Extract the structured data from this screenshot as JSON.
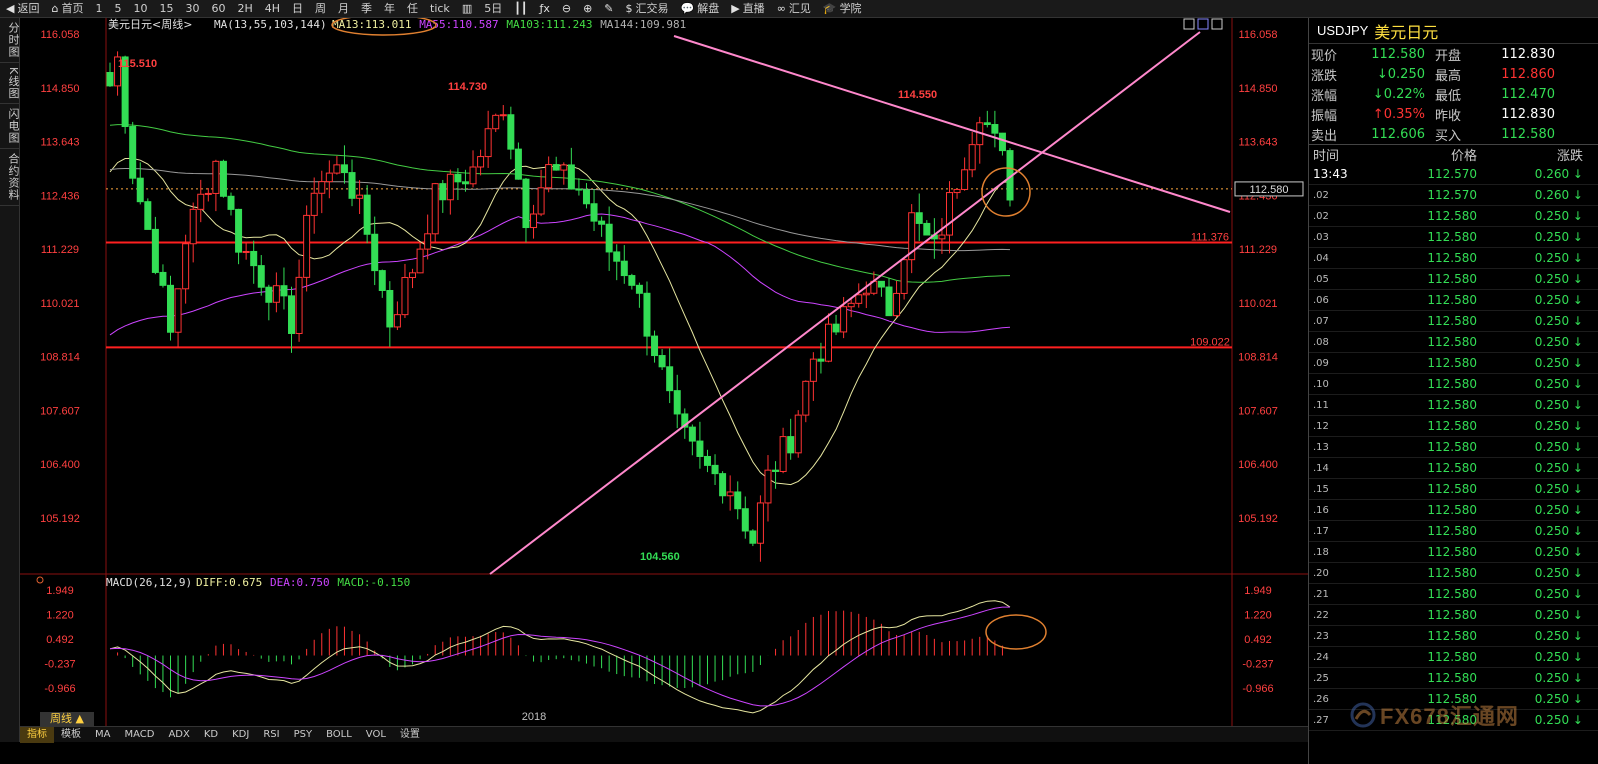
{
  "toolbar": {
    "items": [
      {
        "icon": "back-arrow-icon",
        "glyph": "◀",
        "label": "返回"
      },
      {
        "icon": "home-icon",
        "glyph": "⌂",
        "label": "首页"
      },
      {
        "label": "1"
      },
      {
        "label": "5"
      },
      {
        "label": "10"
      },
      {
        "label": "15"
      },
      {
        "label": "30"
      },
      {
        "label": "60"
      },
      {
        "label": "2H"
      },
      {
        "label": "4H"
      },
      {
        "label": "日"
      },
      {
        "label": "周"
      },
      {
        "label": "月"
      },
      {
        "label": "季"
      },
      {
        "label": "年"
      },
      {
        "label": "任"
      },
      {
        "label": "tick"
      },
      {
        "icon": "candlestick-icon",
        "glyph": "▥",
        "label": ""
      },
      {
        "label": "5日"
      },
      {
        "icon": "bars-icon",
        "glyph": "┃┃",
        "label": ""
      },
      {
        "icon": "fx-icon",
        "glyph": "ƒx",
        "label": ""
      },
      {
        "icon": "zoom-out-icon",
        "glyph": "⊖",
        "label": ""
      },
      {
        "icon": "zoom-in-icon",
        "glyph": "⊕",
        "label": ""
      },
      {
        "icon": "pen-icon",
        "glyph": "✎",
        "label": ""
      },
      {
        "icon": "dollar-icon",
        "glyph": "$",
        "label": "汇交易"
      },
      {
        "icon": "chat-icon",
        "glyph": "💬",
        "label": "解盘"
      },
      {
        "icon": "play-icon",
        "glyph": "▶",
        "label": "直播"
      },
      {
        "icon": "link-icon",
        "glyph": "∞",
        "label": "汇见"
      },
      {
        "icon": "graduation-cap-icon",
        "glyph": "🎓",
        "label": "学院"
      }
    ]
  },
  "left_tabs": [
    "分时图",
    "K线图",
    "闪电图",
    "合约资料"
  ],
  "main_chart": {
    "title": "美元日元<周线>",
    "ma_label": "MA(13,55,103,144)",
    "ma_values": [
      {
        "text": "MA13:113.011",
        "color": "#f0f0a0"
      },
      {
        "text": "MA55:110.587",
        "color": "#cc44ff"
      },
      {
        "text": "MA103:111.243",
        "color": "#44dd44"
      },
      {
        "text": "MA144:109.981",
        "color": "#b0b0b0"
      }
    ],
    "y_ticks": [
      "116.058",
      "114.850",
      "113.643",
      "112.436",
      "111.229",
      "110.021",
      "108.814",
      "107.607",
      "106.400",
      "105.192"
    ],
    "current_price_label": "112.580",
    "hline_labels": [
      "111.376",
      "109.022"
    ],
    "annotations": [
      "115.510",
      "114.730",
      "114.550",
      "104.560"
    ]
  },
  "macd": {
    "label": "MACD(26,12,9)",
    "values": [
      {
        "text": "DIFF:0.675",
        "color": "#f0f0a0"
      },
      {
        "text": "DEA:0.750",
        "color": "#cc44ff"
      },
      {
        "text": "MACD:-0.150",
        "color": "#44dd44"
      }
    ],
    "y_ticks": [
      "1.949",
      "1.220",
      "0.492",
      "-0.237",
      "-0.966"
    ]
  },
  "x_axis_label": "2018",
  "period_tab": "周线 ▲",
  "bottom_tabs": [
    "指标",
    "模板",
    "MA",
    "MACD",
    "ADX",
    "KD",
    "KDJ",
    "RSI",
    "PSY",
    "BOLL",
    "VOL",
    "设置"
  ],
  "right_panel": {
    "code": "USDJPY",
    "name": "美元日元",
    "quotes": [
      {
        "l1": "现价",
        "v1": "112.580",
        "c1": "#33dd55",
        "l2": "开盘",
        "v2": "112.830",
        "c2": "#ffffff"
      },
      {
        "l1": "涨跌",
        "v1": "↓0.250",
        "c1": "#33dd55",
        "l2": "最高",
        "v2": "112.860",
        "c2": "#ff3333"
      },
      {
        "l1": "涨幅",
        "v1": "↓0.22%",
        "c1": "#33dd55",
        "l2": "最低",
        "v2": "112.470",
        "c2": "#33dd55"
      },
      {
        "l1": "振幅",
        "v1": "↑0.35%",
        "c1": "#ff3333",
        "l2": "昨收",
        "v2": "112.830",
        "c2": "#ffffff"
      },
      {
        "l1": "卖出",
        "v1": "112.606",
        "c1": "#33dd55",
        "l2": "买入",
        "v2": "112.580",
        "c2": "#33dd55"
      }
    ],
    "tick_header": {
      "time": "时间",
      "price": "价格",
      "change": "涨跌"
    },
    "ticks": [
      {
        "time": "13:43",
        "price": "112.570",
        "change": "0.260 ↓"
      },
      {
        "time": ".02",
        "price": "112.570",
        "change": "0.260 ↓"
      },
      {
        "time": ".02",
        "price": "112.580",
        "change": "0.250 ↓"
      },
      {
        "time": ".03",
        "price": "112.580",
        "change": "0.250 ↓"
      },
      {
        "time": ".04",
        "price": "112.580",
        "change": "0.250 ↓"
      },
      {
        "time": ".05",
        "price": "112.580",
        "change": "0.250 ↓"
      },
      {
        "time": ".06",
        "price": "112.580",
        "change": "0.250 ↓"
      },
      {
        "time": ".07",
        "price": "112.580",
        "change": "0.250 ↓"
      },
      {
        "time": ".08",
        "price": "112.580",
        "change": "0.250 ↓"
      },
      {
        "time": ".09",
        "price": "112.580",
        "change": "0.250 ↓"
      },
      {
        "time": ".10",
        "price": "112.580",
        "change": "0.250 ↓"
      },
      {
        "time": ".11",
        "price": "112.580",
        "change": "0.250 ↓"
      },
      {
        "time": ".12",
        "price": "112.580",
        "change": "0.250 ↓"
      },
      {
        "time": ".13",
        "price": "112.580",
        "change": "0.250 ↓"
      },
      {
        "time": ".14",
        "price": "112.580",
        "change": "0.250 ↓"
      },
      {
        "time": ".15",
        "price": "112.580",
        "change": "0.250 ↓"
      },
      {
        "time": ".16",
        "price": "112.580",
        "change": "0.250 ↓"
      },
      {
        "time": ".17",
        "price": "112.580",
        "change": "0.250 ↓"
      },
      {
        "time": ".18",
        "price": "112.580",
        "change": "0.250 ↓"
      },
      {
        "time": ".20",
        "price": "112.580",
        "change": "0.250 ↓"
      },
      {
        "time": ".21",
        "price": "112.580",
        "change": "0.250 ↓"
      },
      {
        "time": ".22",
        "price": "112.580",
        "change": "0.250 ↓"
      },
      {
        "time": ".23",
        "price": "112.580",
        "change": "0.250 ↓"
      },
      {
        "time": ".24",
        "price": "112.580",
        "change": "0.250 ↓"
      },
      {
        "time": ".25",
        "price": "112.580",
        "change": "0.250 ↓"
      },
      {
        "time": ".26",
        "price": "112.580",
        "change": "0.250 ↓"
      },
      {
        "time": ".27",
        "price": "112.580",
        "change": "0.250 ↓"
      }
    ]
  },
  "watermark": "FX678汇通网",
  "colors": {
    "up": "#ff3333",
    "down": "#33dd55",
    "bg": "#000000",
    "trendline": "#ff88cc",
    "hline": "#ff2020"
  }
}
